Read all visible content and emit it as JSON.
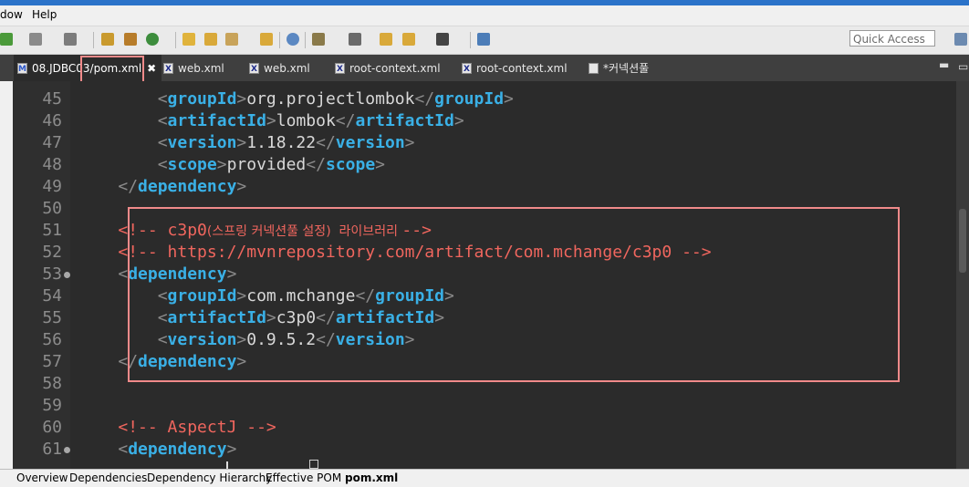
{
  "menu": [
    "dow",
    "Help"
  ],
  "toolbar": {
    "quick_access_placeholder": "Quick Access",
    "icons": [
      "run-icon",
      "stop-icon",
      "debug-icon",
      "new-wizard-icon",
      "package-icon",
      "refresh-icon",
      "open-folder-icon",
      "open-icon",
      "tool-icon",
      "open-type-icon",
      "globe-icon",
      "annotation-icon",
      "search-icon",
      "back-icon",
      "arrow-left-icon",
      "arrow-right-icon",
      "perspective-icon",
      "open-perspective-icon"
    ]
  },
  "tabs": [
    {
      "label": "08.JDBC03/pom.xml",
      "icon": "M",
      "active": true
    },
    {
      "label": "web.xml",
      "icon": "X"
    },
    {
      "label": "web.xml",
      "icon": "X"
    },
    {
      "label": "root-context.xml",
      "icon": "X"
    },
    {
      "label": "root-context.xml",
      "icon": "X"
    },
    {
      "label": "*커넥션풀",
      "icon": "doc"
    }
  ],
  "tab_close_glyph": "✖",
  "editor": {
    "lines": [
      {
        "n": "45",
        "parts": [
          [
            "i",
            "        "
          ],
          [
            "p",
            "<"
          ],
          [
            "t",
            "groupId"
          ],
          [
            "p",
            ">"
          ],
          [
            "x",
            "org.projectlombok"
          ],
          [
            "p",
            "</"
          ],
          [
            "t",
            "groupId"
          ],
          [
            "p",
            ">"
          ]
        ]
      },
      {
        "n": "46",
        "parts": [
          [
            "i",
            "        "
          ],
          [
            "p",
            "<"
          ],
          [
            "t",
            "artifactId"
          ],
          [
            "p",
            ">"
          ],
          [
            "x",
            "lombok"
          ],
          [
            "p",
            "</"
          ],
          [
            "t",
            "artifactId"
          ],
          [
            "p",
            ">"
          ]
        ]
      },
      {
        "n": "47",
        "parts": [
          [
            "i",
            "        "
          ],
          [
            "p",
            "<"
          ],
          [
            "t",
            "version"
          ],
          [
            "p",
            ">"
          ],
          [
            "x",
            "1.18.22"
          ],
          [
            "p",
            "</"
          ],
          [
            "t",
            "version"
          ],
          [
            "p",
            ">"
          ]
        ]
      },
      {
        "n": "48",
        "parts": [
          [
            "i",
            "        "
          ],
          [
            "p",
            "<"
          ],
          [
            "t",
            "scope"
          ],
          [
            "p",
            ">"
          ],
          [
            "x",
            "provided"
          ],
          [
            "p",
            "</"
          ],
          [
            "t",
            "scope"
          ],
          [
            "p",
            ">"
          ]
        ]
      },
      {
        "n": "49",
        "parts": [
          [
            "i",
            "    "
          ],
          [
            "p",
            "</"
          ],
          [
            "t",
            "dependency"
          ],
          [
            "p",
            ">"
          ]
        ]
      },
      {
        "n": "50",
        "parts": []
      },
      {
        "n": "51",
        "parts": [
          [
            "i",
            "    "
          ],
          [
            "c",
            "<!-- c3p0"
          ],
          [
            "k",
            "(스프링 커넥션풀 설정)  라이브러리 "
          ],
          [
            "c",
            "-->"
          ]
        ]
      },
      {
        "n": "52",
        "parts": [
          [
            "i",
            "    "
          ],
          [
            "c",
            "<!-- https://mvnrepository.com/artifact/com.mchange/c3p0 -->"
          ]
        ]
      },
      {
        "n": "53",
        "fold": true,
        "parts": [
          [
            "i",
            "    "
          ],
          [
            "p",
            "<"
          ],
          [
            "t",
            "dependency"
          ],
          [
            "p",
            ">"
          ]
        ]
      },
      {
        "n": "54",
        "parts": [
          [
            "i",
            "        "
          ],
          [
            "p",
            "<"
          ],
          [
            "t",
            "groupId"
          ],
          [
            "p",
            ">"
          ],
          [
            "x",
            "com.mchange"
          ],
          [
            "p",
            "</"
          ],
          [
            "t",
            "groupId"
          ],
          [
            "p",
            ">"
          ]
        ]
      },
      {
        "n": "55",
        "parts": [
          [
            "i",
            "        "
          ],
          [
            "p",
            "<"
          ],
          [
            "t",
            "artifactId"
          ],
          [
            "p",
            ">"
          ],
          [
            "x",
            "c3p0"
          ],
          [
            "p",
            "</"
          ],
          [
            "t",
            "artifactId"
          ],
          [
            "p",
            ">"
          ]
        ]
      },
      {
        "n": "56",
        "parts": [
          [
            "i",
            "        "
          ],
          [
            "p",
            "<"
          ],
          [
            "t",
            "version"
          ],
          [
            "p",
            ">"
          ],
          [
            "x",
            "0.9.5.2"
          ],
          [
            "p",
            "</"
          ],
          [
            "t",
            "version"
          ],
          [
            "p",
            ">"
          ]
        ]
      },
      {
        "n": "57",
        "parts": [
          [
            "i",
            "    "
          ],
          [
            "p",
            "</"
          ],
          [
            "t",
            "dependency"
          ],
          [
            "p",
            ">"
          ]
        ]
      },
      {
        "n": "58",
        "parts": []
      },
      {
        "n": "59",
        "parts": []
      },
      {
        "n": "60",
        "parts": [
          [
            "i",
            "    "
          ],
          [
            "c",
            "<!-- AspectJ -->"
          ]
        ]
      },
      {
        "n": "61",
        "fold": true,
        "parts": [
          [
            "i",
            "    "
          ],
          [
            "p",
            "<"
          ],
          [
            "t",
            "dependency"
          ],
          [
            "p",
            ">"
          ]
        ]
      }
    ]
  },
  "bottom_tabs": [
    {
      "label": "Overview"
    },
    {
      "label": "Dependencies"
    },
    {
      "label": "Dependency Hierarchy"
    },
    {
      "label": "Effective POM"
    },
    {
      "label": "pom.xml",
      "active": true
    }
  ]
}
